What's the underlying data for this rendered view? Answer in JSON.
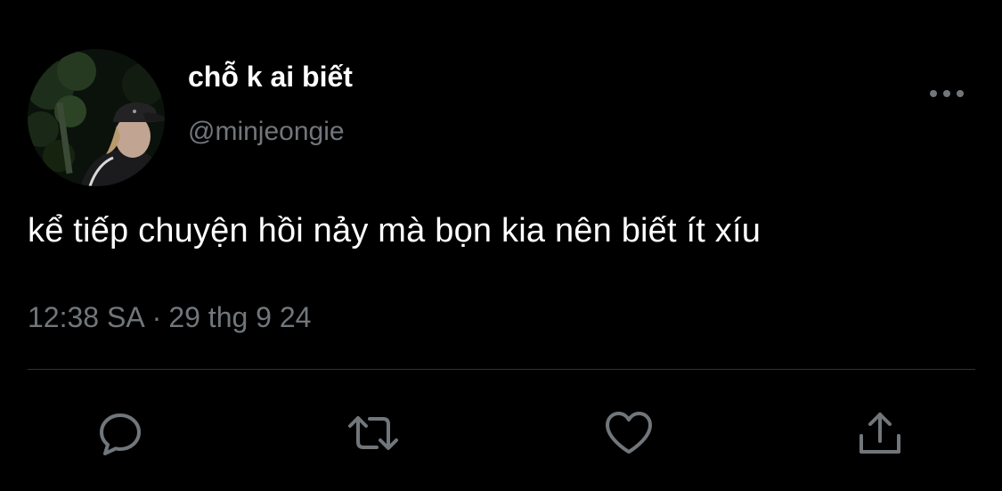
{
  "user": {
    "display_name": "chỗ k ai biết",
    "handle": "@minjeongie"
  },
  "tweet": {
    "text": "kể tiếp chuyện hồi nảy mà bọn kia nên biết ít xíu",
    "time": "12:38 SA",
    "separator": "·",
    "date": "29 thg 9 24"
  },
  "icons": {
    "more": "more-horizontal-icon",
    "reply": "reply-icon",
    "retweet": "retweet-icon",
    "like": "like-icon",
    "share": "share-icon"
  },
  "colors": {
    "background": "#000000",
    "primary_text": "#ffffff",
    "secondary_text": "#71767b",
    "divider": "#2f3336",
    "icon": "#71767b"
  }
}
